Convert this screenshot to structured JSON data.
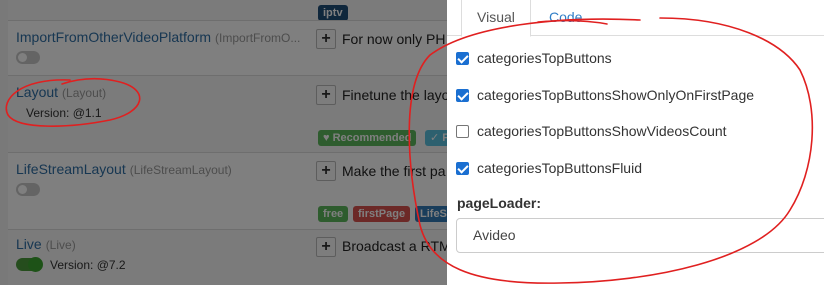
{
  "background_list": {
    "badge_top": "iptv",
    "rows": [
      {
        "name": "ImportFromOtherVideoPlatform",
        "subname": "(ImportFromO...",
        "description": "For now only PH",
        "version": ""
      },
      {
        "name": "Layout",
        "subname": "(Layout)",
        "version": "Version: @1.1",
        "description": "Finetune the layo",
        "badges": [
          "♥ Recommended",
          "✓ F"
        ]
      },
      {
        "name": "LifeStreamLayout",
        "subname": "(LifeStreamLayout)",
        "description": "Make the first pa",
        "badges": [
          "free",
          "firstPage",
          "LifeS"
        ]
      },
      {
        "name": "Live",
        "subname": "(Live)",
        "version": "Version: @7.2",
        "description": "Broadcast a RTM"
      }
    ],
    "add_label": "+"
  },
  "dialog": {
    "tabs": [
      "Visual",
      "Code"
    ],
    "options": [
      {
        "label": "categoriesTopButtons",
        "checked": true
      },
      {
        "label": "categoriesTopButtonsShowOnlyOnFirstPage",
        "checked": true
      },
      {
        "label": "categoriesTopButtonsShowVideosCount",
        "checked": false
      },
      {
        "label": "categoriesTopButtonsFluid",
        "checked": true
      }
    ],
    "page_loader_label": "pageLoader:",
    "page_loader_value": "Avideo"
  },
  "colors": {
    "annotation": "#e02020",
    "link": "#2f7dc6",
    "checkbox": "#1a6fd1",
    "badge_green": "#5cb85c",
    "badge_red": "#d9534f",
    "badge_blue": "#337ab7",
    "badge_navy": "#1f4e79"
  }
}
